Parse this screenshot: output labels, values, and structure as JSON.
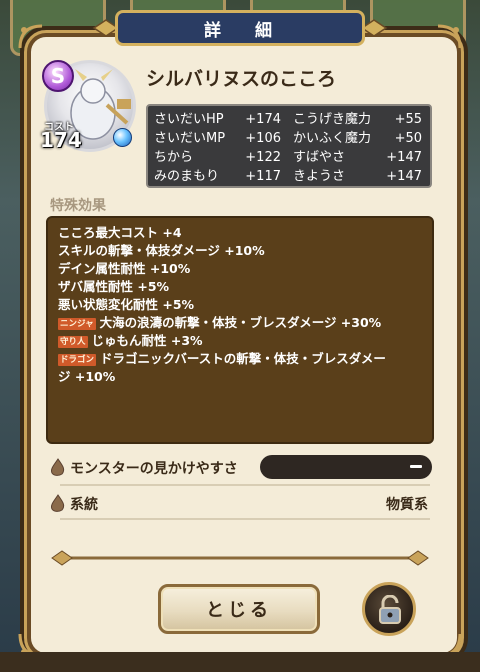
{
  "dialog": {
    "title": "詳 細"
  },
  "monster": {
    "rank": "S",
    "cost_label": "コスト",
    "cost": "174",
    "name": "シルバリヌスのこころ"
  },
  "stats": [
    {
      "left_name": "さいだいHP",
      "left_value": "+174",
      "right_name": "こうげき魔力",
      "right_value": "+55"
    },
    {
      "left_name": "さいだいMP",
      "left_value": "+106",
      "right_name": "かいふく魔力",
      "right_value": "+50"
    },
    {
      "left_name": "ちから",
      "left_value": "+122",
      "right_name": "すばやさ",
      "right_value": "+147"
    },
    {
      "left_name": "みのまもり",
      "left_value": "+117",
      "right_name": "きようさ",
      "right_value": "+147"
    }
  ],
  "effects": {
    "section_label": "特殊効果",
    "lines": [
      {
        "tag": "",
        "text": "こころ最大コスト +4"
      },
      {
        "tag": "",
        "text": "スキルの斬撃・体技ダメージ +10%"
      },
      {
        "tag": "",
        "text": "デイン属性耐性 +10%"
      },
      {
        "tag": "",
        "text": "ザバ属性耐性 +5%"
      },
      {
        "tag": "",
        "text": "悪い状態変化耐性 +5%"
      },
      {
        "tag": "ニンジャ",
        "text": "大海の浪濤の斬撃・体技・ブレスダメージ +30%"
      },
      {
        "tag": "守り人",
        "text": "じゅもん耐性 +3%"
      },
      {
        "tag": "ドラゴン",
        "text": "ドラゴニックバーストの斬撃・体技・ブレスダメー"
      },
      {
        "tag": "",
        "text": "ジ +10%"
      }
    ]
  },
  "visibility": {
    "label": "モンスターの見かけやすさ",
    "value": "ー"
  },
  "family": {
    "label": "系統",
    "value": "物質系"
  },
  "buttons": {
    "close": "とじる"
  },
  "colors": {
    "panel": "#f4ecd8",
    "effects_bg": "#5a3f1a",
    "title_plate": "#2a3c63",
    "tag": "#d05a2a"
  },
  "icons": {
    "lock": "lock-open-icon",
    "seed": "seed-icon",
    "orb": "element-orb-icon"
  }
}
